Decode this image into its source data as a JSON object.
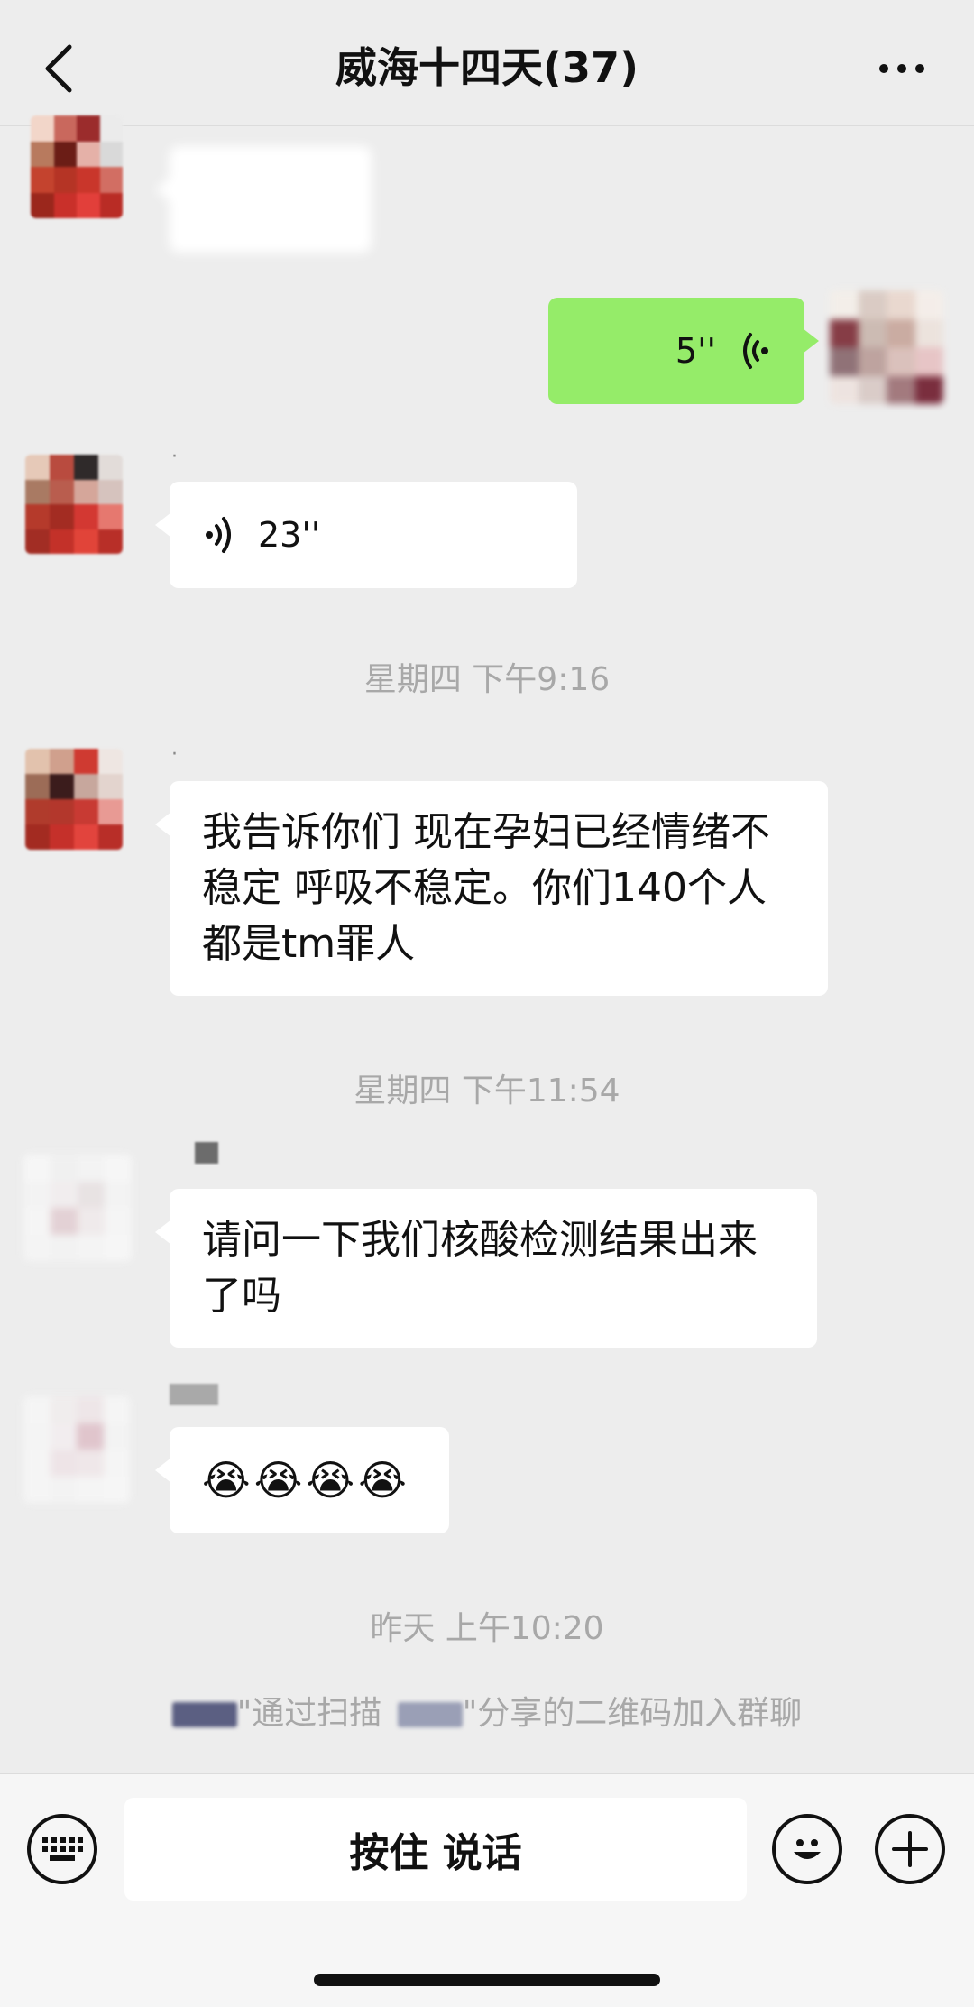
{
  "header": {
    "title": "威海十四天(37)"
  },
  "messages": {
    "voice_out_duration": "5''",
    "voice_in_duration": "23''",
    "time_1": "星期四 下午9:16",
    "text_1": "我告诉你们 现在孕妇已经情绪不稳定 呼吸不稳定。你们140个人都是tm罪人",
    "time_2": "星期四 下午11:54",
    "text_2": "请问一下我们核酸检测结果出来了吗",
    "emoji_msg": "😭😭😭😭",
    "time_3": "昨天 上午10:20",
    "system_part1": "\"通过扫描",
    "system_part2": "\"分享的二维码加入群聊"
  },
  "input_bar": {
    "hold_to_talk": "按住 说话"
  },
  "colors": {
    "background": "#ededed",
    "outgoing_bubble": "#95ec69",
    "incoming_bubble": "#ffffff",
    "timestamp_text": "#a8a8a8"
  },
  "icons": [
    "back-chevron-icon",
    "more-dots-icon",
    "voice-wave-icon",
    "keyboard-icon",
    "emoji-icon",
    "plus-icon"
  ]
}
